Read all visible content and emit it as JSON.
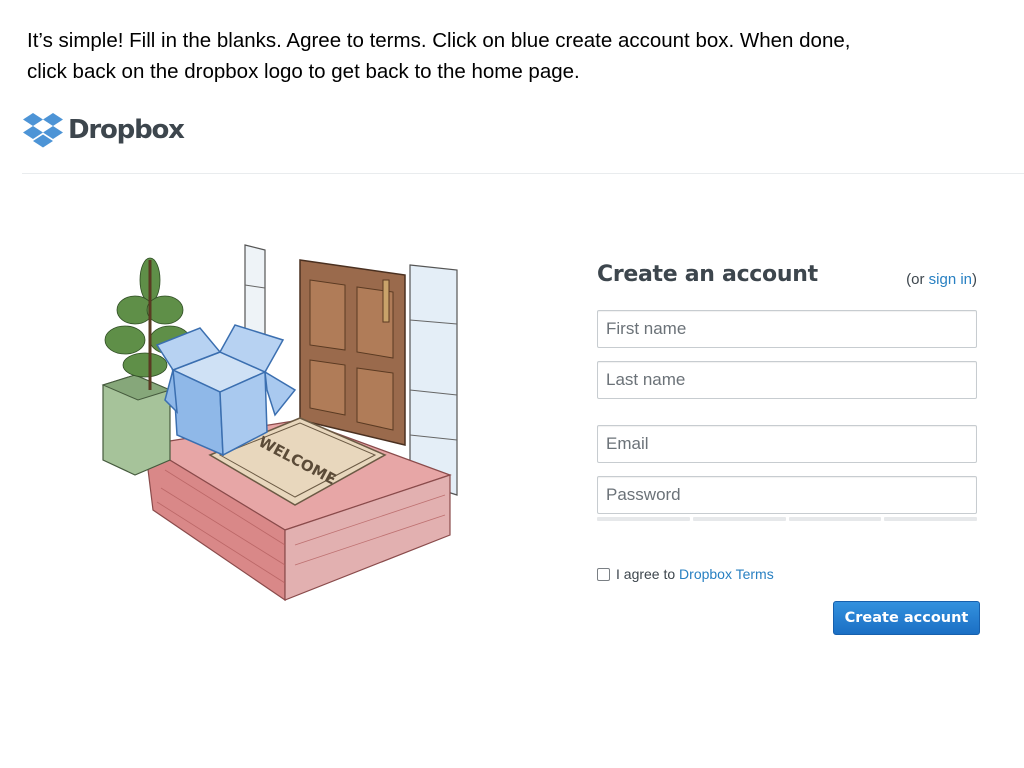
{
  "instructions": {
    "line1": "It’s simple!  Fill in the blanks. Agree to terms.  Click on blue create account box. When done,",
    "line2": "click back on the dropbox logo to get back to the home page."
  },
  "header": {
    "logo_text": "Dropbox",
    "logo_icon": "dropbox-box-icon"
  },
  "illustration": {
    "mat_text": "WELCOME"
  },
  "form": {
    "title": "Create an account",
    "signin_prefix": "(or ",
    "signin_link": "sign in",
    "signin_suffix": ")",
    "fields": {
      "first_name": {
        "placeholder": "First name",
        "value": ""
      },
      "last_name": {
        "placeholder": "Last name",
        "value": ""
      },
      "email": {
        "placeholder": "Email",
        "value": ""
      },
      "password": {
        "placeholder": "Password",
        "value": ""
      }
    },
    "agree_prefix": "I agree to ",
    "agree_link": "Dropbox Terms",
    "agree_checked": false,
    "submit_label": "Create account"
  },
  "colors": {
    "link": "#2880c2",
    "button": "#2179ca",
    "logo_blue": "#4d94d6",
    "title_gray": "#3d464d"
  }
}
